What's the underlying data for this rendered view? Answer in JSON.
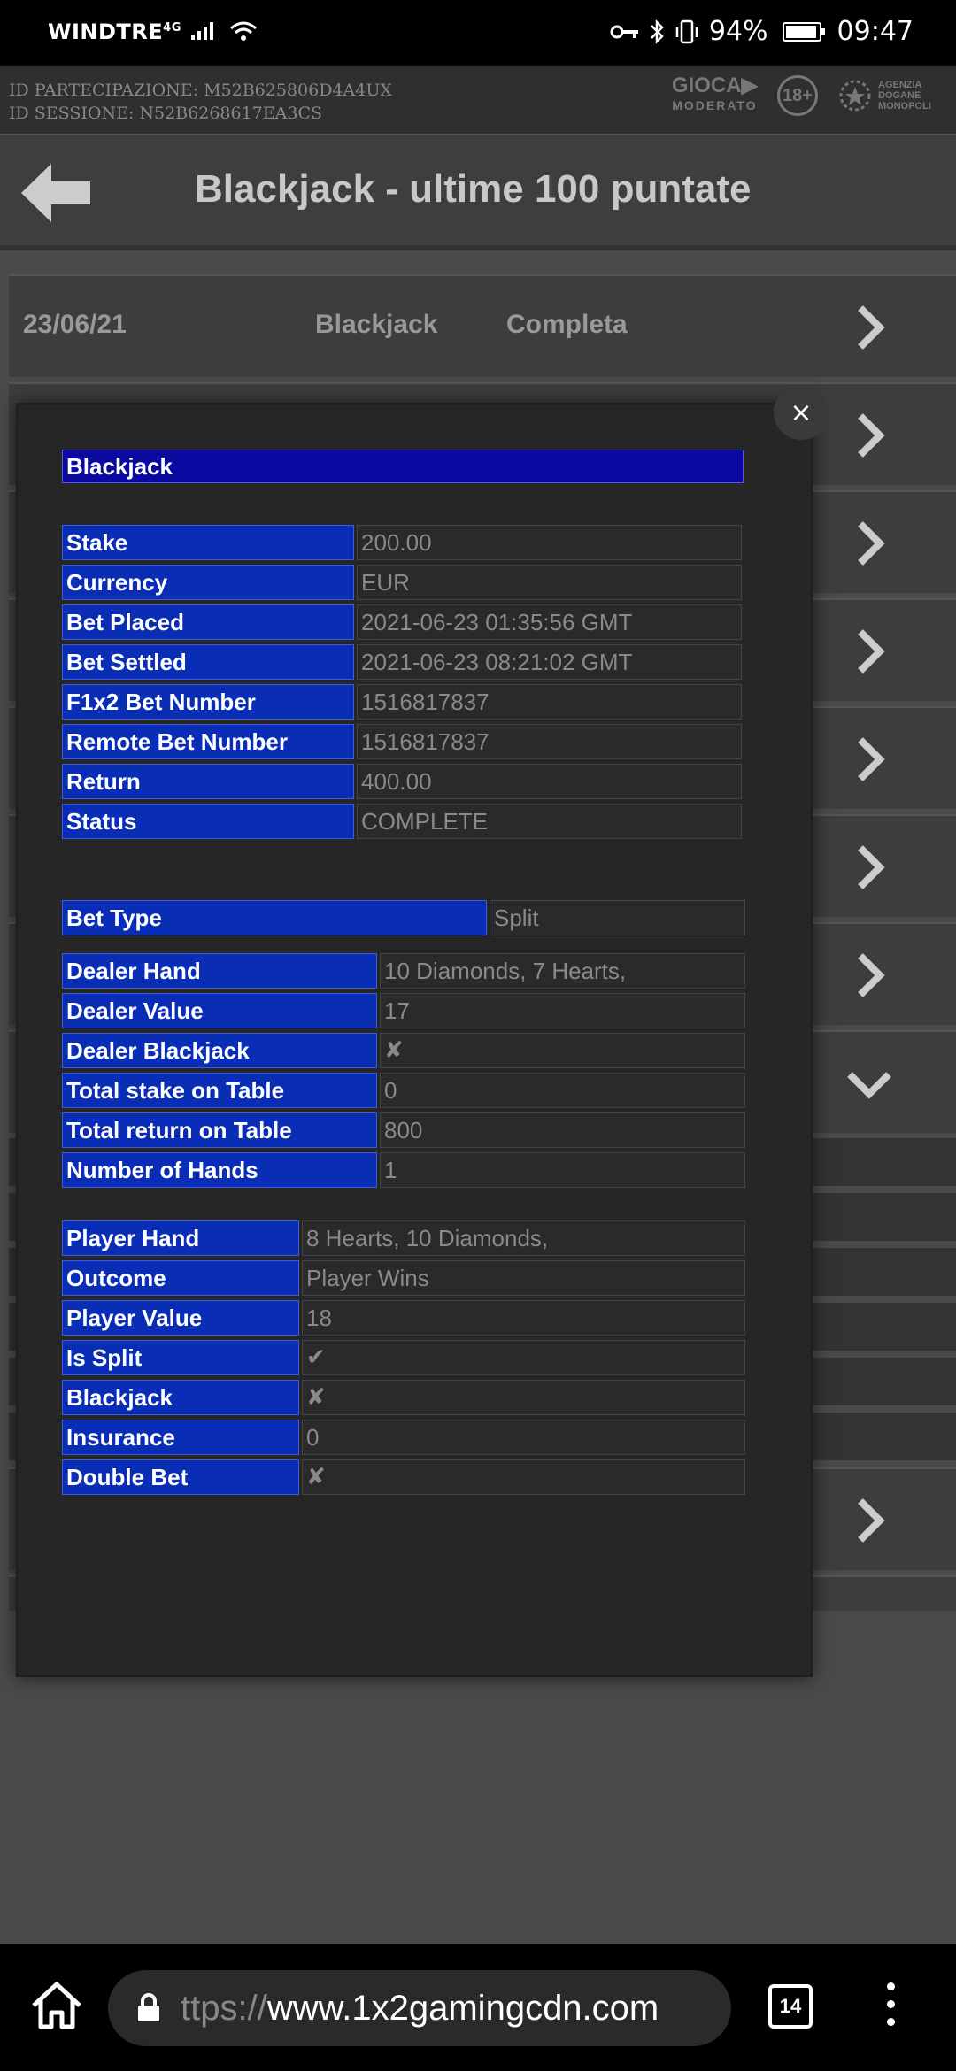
{
  "status_bar": {
    "carrier": "WINDTRE",
    "network": "4G",
    "battery": "94%",
    "time": "09:47"
  },
  "session": {
    "participation": "ID PARTECIPAZIONE: M52B625806D4A4UX",
    "session": "ID SESSIONE: N52B6268617EA3CS"
  },
  "logos": {
    "gioca_top": "GIOCA",
    "gioca_bottom": "MODERATO",
    "age": "18+",
    "adm": "AGENZIA DOGANE MONOPOLI"
  },
  "header": {
    "title": "Blackjack - ultime 100 puntate"
  },
  "list": {
    "first_row": {
      "date": "23/06/21",
      "game": "Blackjack",
      "state": "Completa"
    }
  },
  "modal": {
    "close": "×",
    "title": "Blackjack",
    "bet_info": [
      {
        "key": "Stake",
        "value": "200.00"
      },
      {
        "key": "Currency",
        "value": "EUR"
      },
      {
        "key": "Bet Placed",
        "value": "2021-06-23 01:35:56 GMT"
      },
      {
        "key": "Bet Settled",
        "value": "2021-06-23 08:21:02 GMT"
      },
      {
        "key": "F1x2 Bet Number",
        "value": "1516817837"
      },
      {
        "key": "Remote Bet Number",
        "value": "1516817837"
      },
      {
        "key": "Return",
        "value": "400.00"
      },
      {
        "key": "Status",
        "value": "COMPLETE"
      }
    ],
    "bet_type": {
      "key": "Bet Type",
      "value": "Split"
    },
    "dealer": [
      {
        "key": "Dealer Hand",
        "value": "10 Diamonds, 7 Hearts,"
      },
      {
        "key": "Dealer Value",
        "value": "17"
      },
      {
        "key": "Dealer Blackjack",
        "value": "✘"
      },
      {
        "key": "Total stake on Table",
        "value": "0"
      },
      {
        "key": "Total return on Table",
        "value": "800"
      },
      {
        "key": "Number of Hands",
        "value": "1"
      }
    ],
    "player": [
      {
        "key": "Player Hand",
        "value": "8 Hearts, 10 Diamonds,"
      },
      {
        "key": "Outcome",
        "value": "Player Wins"
      },
      {
        "key": "Player Value",
        "value": "18"
      },
      {
        "key": "Is Split",
        "value": "✔"
      },
      {
        "key": "Blackjack",
        "value": "✘"
      },
      {
        "key": "Insurance",
        "value": "0"
      },
      {
        "key": "Double Bet",
        "value": "✘"
      }
    ]
  },
  "browser": {
    "url_scheme": "ttps://",
    "url_host": "www.1x2gamingcdn.com",
    "tab_count": "14"
  }
}
